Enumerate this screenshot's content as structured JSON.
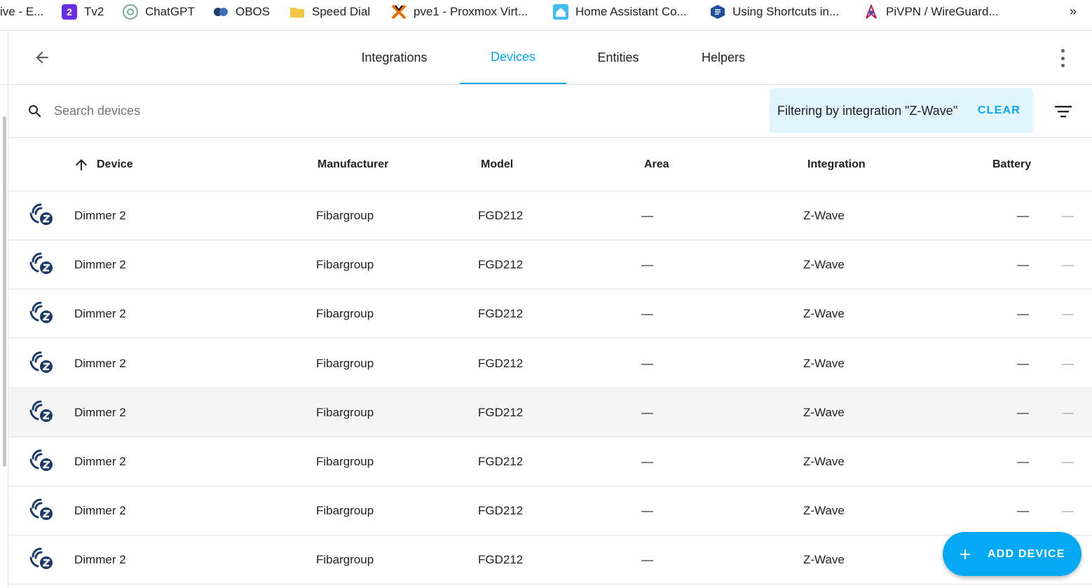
{
  "bookmarks": [
    {
      "label": "ive - E...",
      "icon": "partial-icon"
    },
    {
      "label": "Tv2",
      "icon": "tv2-icon"
    },
    {
      "label": "ChatGPT",
      "icon": "chatgpt-icon"
    },
    {
      "label": "OBOS",
      "icon": "obos-icon"
    },
    {
      "label": "Speed Dial",
      "icon": "folder-icon"
    },
    {
      "label": "pve1 - Proxmox Virt...",
      "icon": "proxmox-icon"
    },
    {
      "label": "Home Assistant Co...",
      "icon": "home-assistant-icon"
    },
    {
      "label": "Using Shortcuts in...",
      "icon": "shortcuts-icon"
    },
    {
      "label": "PiVPN / WireGuard...",
      "icon": "pivpn-icon"
    }
  ],
  "bookmarks_more": "»",
  "tabs": [
    {
      "label": "Integrations",
      "active": false
    },
    {
      "label": "Devices",
      "active": true
    },
    {
      "label": "Entities",
      "active": false
    },
    {
      "label": "Helpers",
      "active": false
    }
  ],
  "search": {
    "placeholder": "Search devices",
    "value": ""
  },
  "filter": {
    "text": "Filtering by integration \"Z-Wave\"",
    "clear_label": "CLEAR"
  },
  "table": {
    "columns": [
      "Device",
      "Manufacturer",
      "Model",
      "Area",
      "Integration",
      "Battery"
    ],
    "sort": {
      "column": "Device",
      "direction": "ascending"
    },
    "rows": [
      {
        "device": "Dimmer 2",
        "manufacturer": "Fibargroup",
        "model": "FGD212",
        "area": "—",
        "integration": "Z-Wave",
        "battery": "—",
        "extra": "—"
      },
      {
        "device": "Dimmer 2",
        "manufacturer": "Fibargroup",
        "model": "FGD212",
        "area": "—",
        "integration": "Z-Wave",
        "battery": "—",
        "extra": "—"
      },
      {
        "device": "Dimmer 2",
        "manufacturer": "Fibargroup",
        "model": "FGD212",
        "area": "—",
        "integration": "Z-Wave",
        "battery": "—",
        "extra": "—"
      },
      {
        "device": "Dimmer 2",
        "manufacturer": "Fibargroup",
        "model": "FGD212",
        "area": "—",
        "integration": "Z-Wave",
        "battery": "—",
        "extra": "—"
      },
      {
        "device": "Dimmer 2",
        "manufacturer": "Fibargroup",
        "model": "FGD212",
        "area": "—",
        "integration": "Z-Wave",
        "battery": "—",
        "extra": "—"
      },
      {
        "device": "Dimmer 2",
        "manufacturer": "Fibargroup",
        "model": "FGD212",
        "area": "—",
        "integration": "Z-Wave",
        "battery": "—",
        "extra": "—"
      },
      {
        "device": "Dimmer 2",
        "manufacturer": "Fibargroup",
        "model": "FGD212",
        "area": "—",
        "integration": "Z-Wave",
        "battery": "—",
        "extra": "—"
      },
      {
        "device": "Dimmer 2",
        "manufacturer": "Fibargroup",
        "model": "FGD212",
        "area": "—",
        "integration": "Z-Wave",
        "battery": "—",
        "extra": "—"
      }
    ],
    "row_icon": "zwave-icon"
  },
  "fab": {
    "label": "ADD DEVICE",
    "icon": "plus-icon"
  },
  "colors": {
    "accent": "#03a9f4",
    "filter_bg": "#e1f5fe",
    "zwave_icon": "#1a3a6b",
    "hover_row": "#f5f5f5"
  }
}
